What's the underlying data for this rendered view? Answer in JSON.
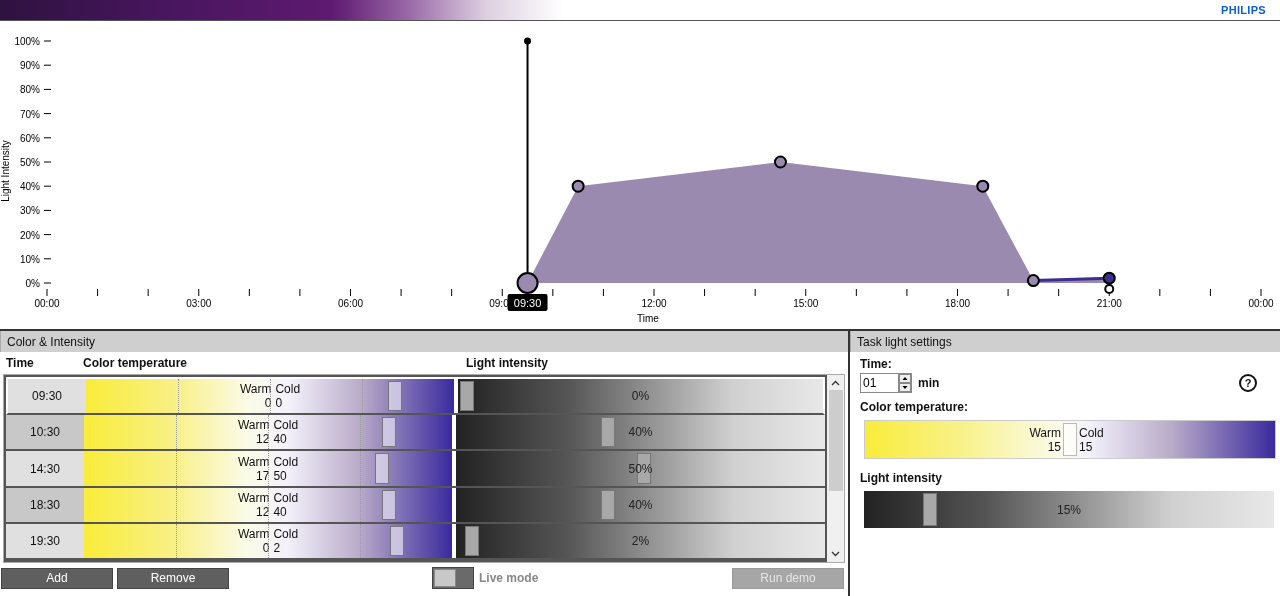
{
  "header": {
    "brand": "PHILIPS"
  },
  "chart": {
    "chart_data": {
      "type": "area",
      "xlabel": "Time",
      "ylabel": "Light Intensity",
      "x": [
        9.5,
        10.5,
        14.5,
        18.5,
        19.5,
        21
      ],
      "series": [
        {
          "color": "#9a8ab0",
          "values": [
            0,
            40,
            50,
            40,
            1,
            2
          ]
        }
      ],
      "xlim": [
        0,
        24
      ],
      "ylim": [
        0,
        100
      ],
      "xticks": [
        {
          "value": 0,
          "label": "00:00"
        },
        {
          "value": 3,
          "label": "03:00"
        },
        {
          "value": 6,
          "label": "06:00"
        },
        {
          "value": 9,
          "label": "09:0"
        },
        {
          "value": 12,
          "label": "12:00"
        },
        {
          "value": 15,
          "label": "15:00"
        },
        {
          "value": 18,
          "label": "18:00"
        },
        {
          "value": 21,
          "label": "21:00"
        },
        {
          "value": 24,
          "label": "00:00"
        }
      ],
      "yticks": [
        {
          "value": 0,
          "label": "0%"
        },
        {
          "value": 10,
          "label": "10%"
        },
        {
          "value": 20,
          "label": "20%"
        },
        {
          "value": 30,
          "label": "30%"
        },
        {
          "value": 40,
          "label": "40%"
        },
        {
          "value": 50,
          "label": "50%"
        },
        {
          "value": 60,
          "label": "60%"
        },
        {
          "value": 70,
          "label": "70%"
        },
        {
          "value": 80,
          "label": "80%"
        },
        {
          "value": 90,
          "label": "90%"
        },
        {
          "value": 100,
          "label": "100%"
        }
      ]
    },
    "cursor_label": "09:30"
  },
  "color_intensity": {
    "title": "Color & Intensity",
    "columns": [
      "Time",
      "Color temperature",
      "Light intensity"
    ],
    "rows": [
      {
        "time": "09:30",
        "selected": true,
        "color": {
          "warm_label": "Warm",
          "warm": "0",
          "cold_label": "Cold",
          "cold": "0",
          "level": 0.84
        },
        "intensity": {
          "text": "0%",
          "level": 0
        }
      },
      {
        "time": "10:30",
        "selected": false,
        "color": {
          "warm_label": "Warm",
          "warm": "12",
          "cold_label": "Cold",
          "cold": "40",
          "level": 0.83
        },
        "intensity": {
          "text": "40%",
          "level": 0.4
        }
      },
      {
        "time": "14:30",
        "selected": false,
        "color": {
          "warm_label": "Warm",
          "warm": "17",
          "cold_label": "Cold",
          "cold": "50",
          "level": 0.81
        },
        "intensity": {
          "text": "50%",
          "level": 0.5
        }
      },
      {
        "time": "18:30",
        "selected": false,
        "color": {
          "warm_label": "Warm",
          "warm": "12",
          "cold_label": "Cold",
          "cold": "40",
          "level": 0.83
        },
        "intensity": {
          "text": "40%",
          "level": 0.4
        }
      },
      {
        "time": "19:30",
        "selected": false,
        "color": {
          "warm_label": "Warm",
          "warm": "0",
          "cold_label": "Cold",
          "cold": "2",
          "level": 0.85
        },
        "intensity": {
          "text": "2%",
          "level": 0.02
        }
      }
    ],
    "add": "Add",
    "remove": "Remove",
    "live_mode": {
      "label": "Live mode",
      "on": false
    },
    "run_demo": {
      "label": "Run demo",
      "disabled": true
    }
  },
  "task_light": {
    "title": "Task light settings",
    "time_label": "Time:",
    "time_value": "01",
    "time_unit": "min",
    "help": "?",
    "color_label": "Color temperature:",
    "color": {
      "warm_label": "Warm",
      "warm": "15",
      "cold_label": "Cold",
      "cold": "15",
      "level": 0.5
    },
    "intensity_label": "Light intensity",
    "intensity": {
      "text": "15%",
      "level": 0.16
    }
  }
}
